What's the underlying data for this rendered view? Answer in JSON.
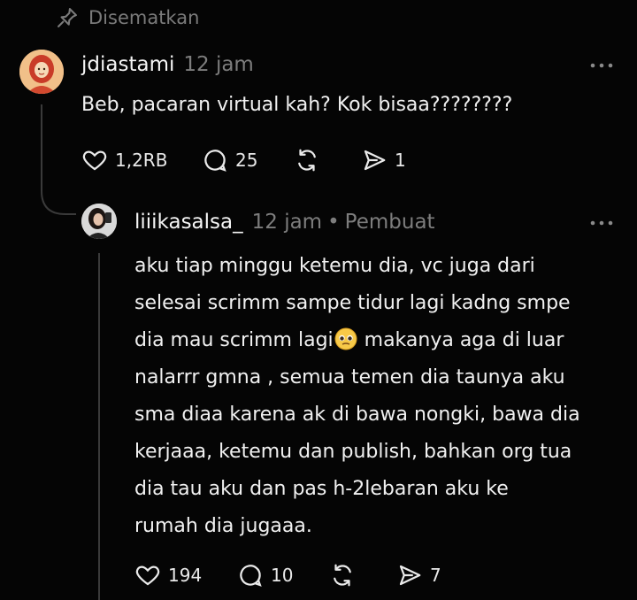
{
  "pinned": {
    "label": "Disematkan"
  },
  "post": {
    "username": "jdiastami",
    "time": "12 jam",
    "text": "Beb, pacaran virtual kah? Kok bisaa????????",
    "likes": "1,2RB",
    "comments": "25",
    "shares": "1",
    "more_icon": "more-icon"
  },
  "reply": {
    "username": "liiikasalsa_",
    "time": "12 jam",
    "separator": "•",
    "role": "Pembuat",
    "lines": [
      "aku tiap minggu ketemu dia, vc juga dari",
      "selesai scrimm sampe tidur lagi kadng smpe",
      "dia mau scrimm lagi",
      " makanya aga di luar",
      "nalarrr gmna , semua temen dia taunya aku",
      "sma diaa karena ak di bawa nongki, bawa dia",
      "kerjaaa, ketemu dan publish, bahkan org tua",
      "dia tau aku dan pas h-2lebaran aku ke",
      "rumah dia jugaaa."
    ],
    "likes": "194",
    "comments": "10",
    "shares": "7"
  },
  "colors": {
    "background": "#050505",
    "text": "#f2f2f2",
    "muted": "#7d7d7d",
    "thread": "#3a3a3a"
  }
}
